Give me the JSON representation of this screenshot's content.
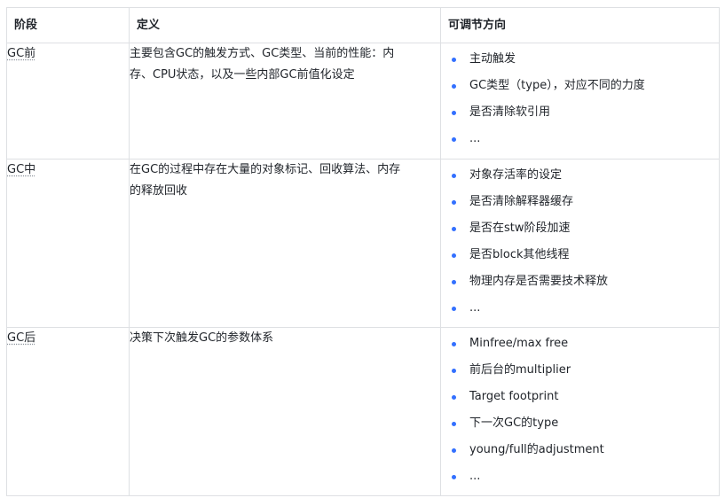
{
  "table": {
    "headers": [
      "阶段",
      "定义",
      "可调节方向"
    ],
    "rows": [
      {
        "stage": "GC前",
        "definition_line1": "主要包含GC的触发方式、GC类型、当前的性能：内",
        "definition_line2": "存、CPU状态，以及一些内部GC前值化设定",
        "directions": [
          "主动触发",
          "GC类型（type），对应不同的力度",
          "是否清除软引用",
          "..."
        ]
      },
      {
        "stage": "GC中",
        "definition_line1": "在GC的过程中存在大量的对象标记、回收算法、内存",
        "definition_line2": "的释放回收",
        "directions": [
          "对象存活率的设定",
          "是否清除解释器缓存",
          "是否在stw阶段加速",
          "是否block其他线程",
          "物理内存是否需要技术释放",
          "..."
        ]
      },
      {
        "stage": "GC后",
        "definition_line1": "决策下次触发GC的参数体系",
        "definition_line2": "",
        "directions": [
          "Minfree/max free",
          "前后台的multiplier",
          "Target footprint",
          "下一次GC的type",
          "young/full的adjustment",
          "..."
        ]
      }
    ]
  },
  "colors": {
    "border": "#dee0e3",
    "bullet": "#3370ff",
    "text": "#1f2329"
  }
}
